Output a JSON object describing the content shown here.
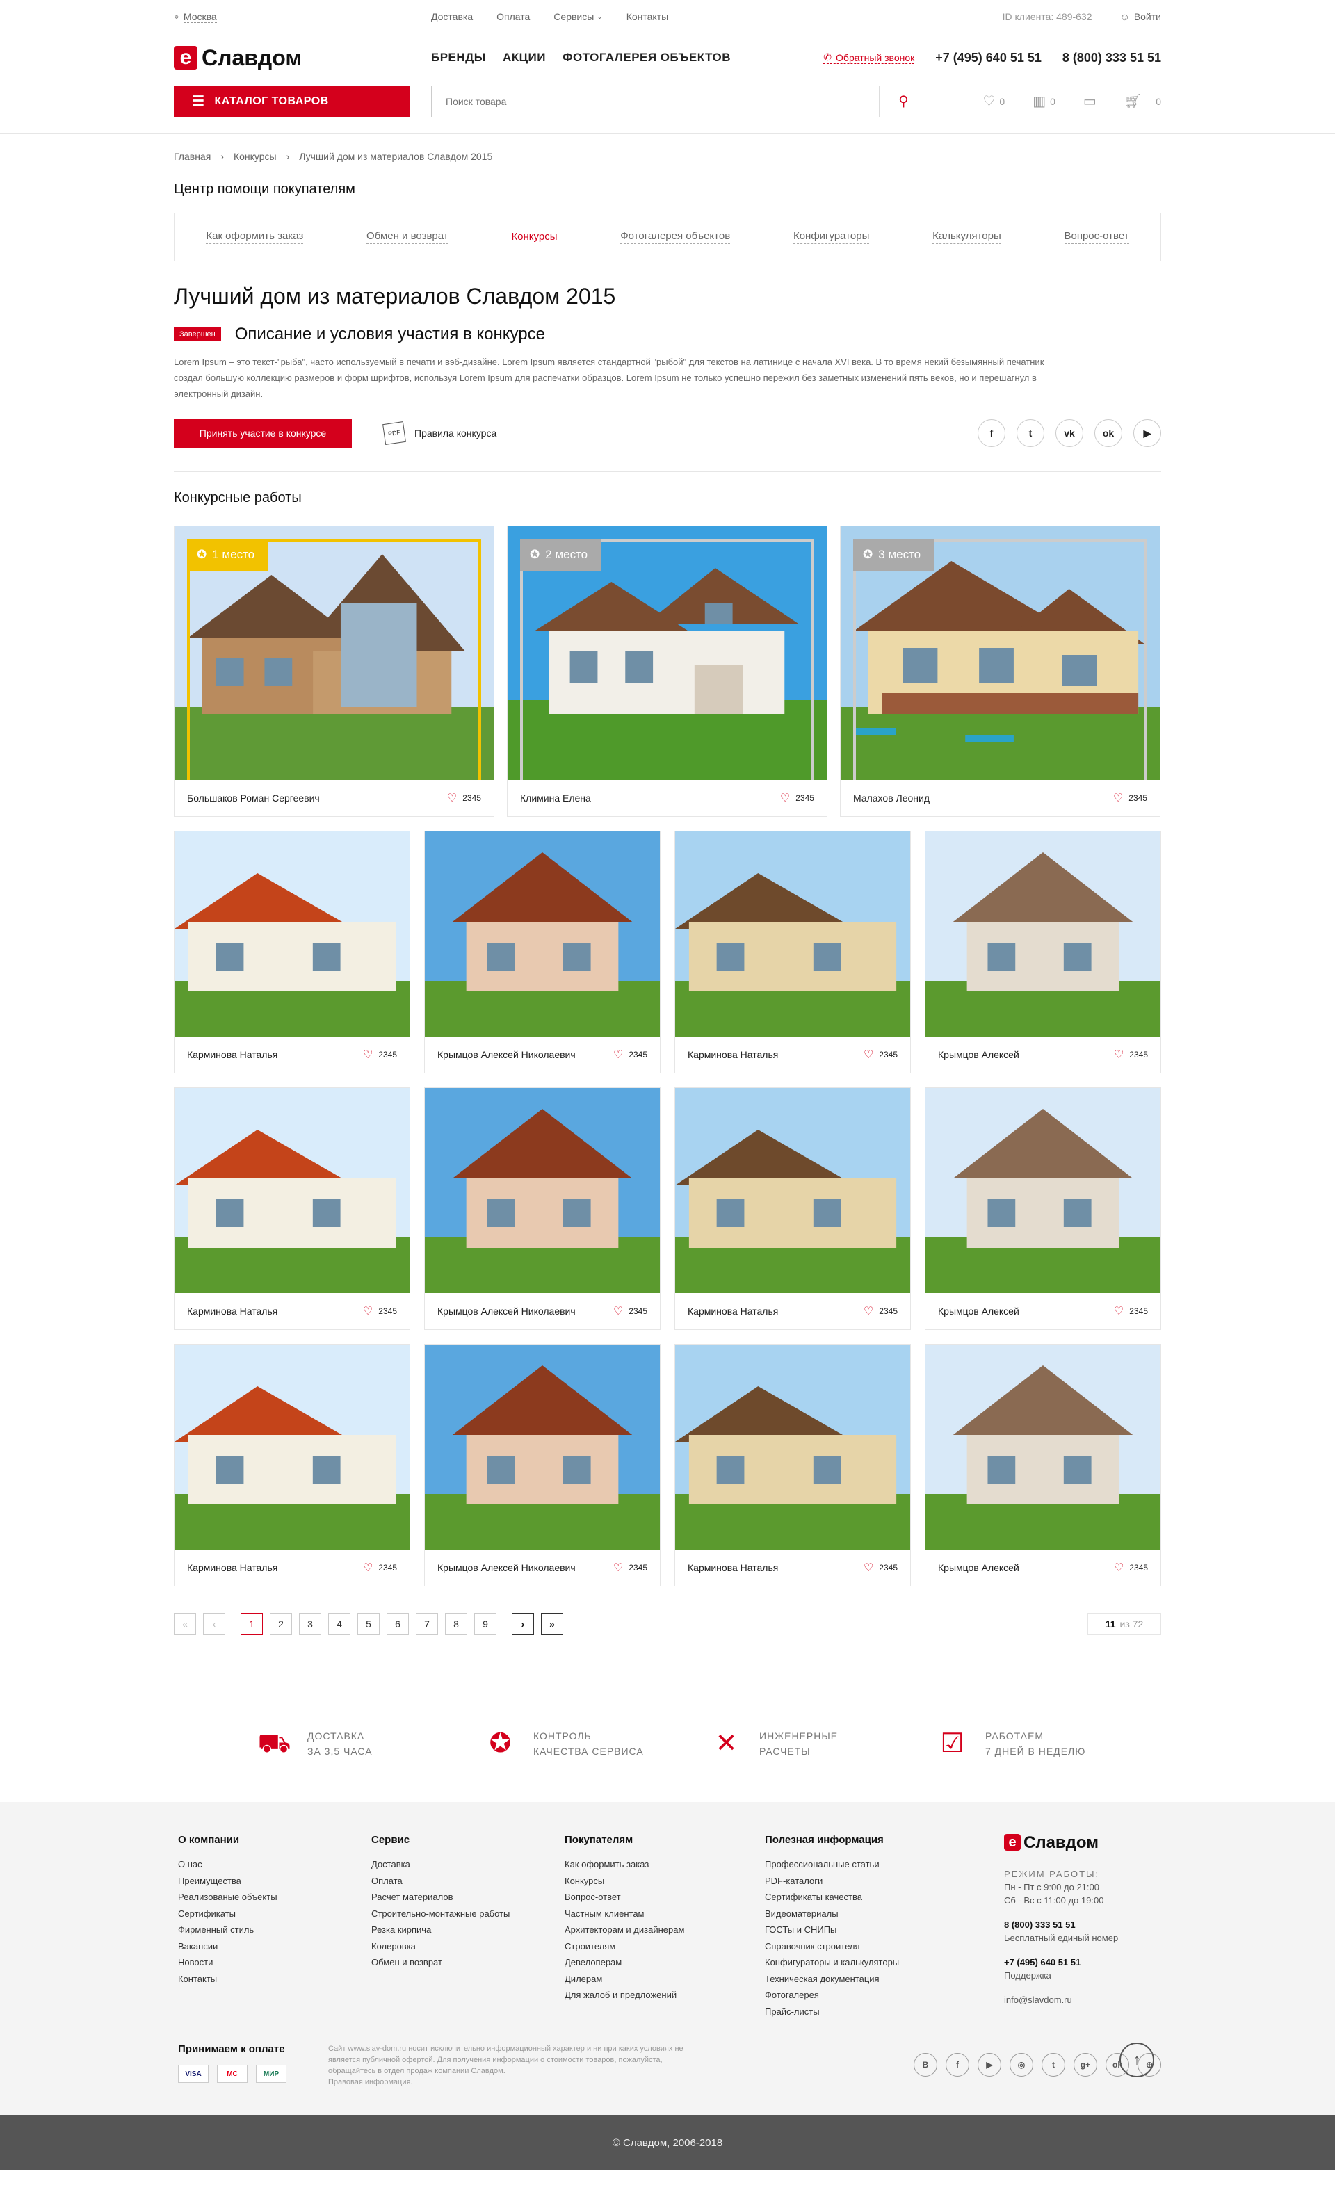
{
  "topbar": {
    "city": "Москва",
    "nav": [
      "Доставка",
      "Оплата",
      "Сервисы",
      "Контакты"
    ],
    "client_id": "ID клиента: 489-632",
    "login": "Войти"
  },
  "header": {
    "logo": "Славдом",
    "nav": [
      "БРЕНДЫ",
      "АКЦИИ",
      "ФОТОГАЛЕРЕЯ ОБЪЕКТОВ"
    ],
    "callback": "Обратный звонок",
    "phone1": "+7 (495) 640 51 51",
    "phone2": "8 (800) 333 51 51"
  },
  "search": {
    "catalog": "КАТАЛОГ ТОВАРОВ",
    "placeholder": "Поиск товара",
    "fav_count": "0",
    "compare_count": "0",
    "cart_count": "0"
  },
  "breadcrumbs": [
    "Главная",
    "Конкурсы",
    "Лучший дом из материалов Славдом 2015"
  ],
  "help": {
    "title": "Центр помощи покупателям",
    "tabs": [
      "Как оформить заказ",
      "Обмен и возврат",
      "Конкурсы",
      "Фотогалерея объектов",
      "Конфигураторы",
      "Калькуляторы",
      "Вопрос-ответ"
    ],
    "active": 2
  },
  "contest": {
    "title": "Лучший дом из материалов Славдом 2015",
    "badge": "Завершен",
    "subtitle": "Описание и условия участия в конкурсе",
    "text": "Lorem Ipsum – это текст-\"рыба\", часто используемый в печати и вэб-дизайне. Lorem Ipsum является стандартной \"рыбой\" для текстов на латинице с начала XVI века. В то время некий безымянный печатник создал большую коллекцию размеров и форм шрифтов, используя Lorem Ipsum для распечатки образцов. Lorem Ipsum не только успешно пережил без заметных изменений пять веков, но и перешагнул в электронный дизайн.",
    "join": "Принять участие в конкурсе",
    "rules": "Правила конкурса",
    "pdf": "PDF"
  },
  "socials": [
    "f",
    "t",
    "vk",
    "ok",
    "▶"
  ],
  "works": {
    "title": "Конкурсные работы",
    "top": [
      {
        "place": "1 место",
        "name": "Большаков Роман Сергеевич",
        "likes": "2345"
      },
      {
        "place": "2 место",
        "name": "Климина Елена",
        "likes": "2345"
      },
      {
        "place": "3 место",
        "name": "Малахов Леонид",
        "likes": "2345"
      }
    ],
    "rows": [
      [
        {
          "name": "Карминова Наталья",
          "likes": "2345"
        },
        {
          "name": "Крымцов Алексей Николаевич",
          "likes": "2345"
        },
        {
          "name": "Карминова Наталья",
          "likes": "2345"
        },
        {
          "name": "Крымцов Алексей",
          "likes": "2345"
        }
      ],
      [
        {
          "name": "Карминова Наталья",
          "likes": "2345"
        },
        {
          "name": "Крымцов Алексей Николаевич",
          "likes": "2345"
        },
        {
          "name": "Карминова Наталья",
          "likes": "2345"
        },
        {
          "name": "Крымцов Алексей",
          "likes": "2345"
        }
      ],
      [
        {
          "name": "Карминова Наталья",
          "likes": "2345"
        },
        {
          "name": "Крымцов Алексей Николаевич",
          "likes": "2345"
        },
        {
          "name": "Карминова Наталья",
          "likes": "2345"
        },
        {
          "name": "Крымцов Алексей",
          "likes": "2345"
        }
      ]
    ]
  },
  "pager": {
    "first": "«",
    "prev": "‹",
    "pages": [
      "1",
      "2",
      "3",
      "4",
      "5",
      "6",
      "7",
      "8",
      "9"
    ],
    "next": "›",
    "last": "»",
    "current": "11",
    "of": "из 72"
  },
  "features": [
    {
      "l1": "ДОСТАВКА",
      "l2": "ЗА 3,5 ЧАСА"
    },
    {
      "l1": "КОНТРОЛЬ",
      "l2": "КАЧЕСТВА СЕРВИСА"
    },
    {
      "l1": "ИНЖЕНЕРНЫЕ",
      "l2": "РАСЧЕТЫ"
    },
    {
      "l1": "РАБОТАЕМ",
      "l2": "7 ДНЕЙ В НЕДЕЛЮ"
    }
  ],
  "footer": {
    "cols": [
      {
        "title": "О компании",
        "items": [
          "О нас",
          "Преимущества",
          "Реализованые объекты",
          "Сертификаты",
          "Фирменный стиль",
          "Вакансии",
          "Новости",
          "Контакты"
        ]
      },
      {
        "title": "Сервис",
        "items": [
          "Доставка",
          "Оплата",
          "Расчет материалов",
          "Строительно-монтажные работы",
          "Резка кирпича",
          "Колеровка",
          "Обмен и возврат"
        ]
      },
      {
        "title": "Покупателям",
        "items": [
          "Как оформить заказ",
          "Конкурсы",
          "Вопрос-ответ",
          "Частным клиентам",
          "Архитекторам и дизайнерам",
          "Строителям",
          "Девелоперам",
          "Дилерам",
          "Для жалоб и предложений"
        ]
      },
      {
        "title": "Полезная информация",
        "items": [
          "Профессиональные статьи",
          "PDF-каталоги",
          "Сертификаты качества",
          "Видеоматериалы",
          "ГОСТы и СНИПы",
          "Справочник строителя",
          "Конфигураторы и калькуляторы",
          "Техническая документация",
          "Фотогалерея",
          "Прайс-листы"
        ]
      }
    ],
    "logo": "Славдом",
    "hours_title": "РЕЖИМ РАБОТЫ:",
    "hours1": "Пн - Пт с 9:00 до 21:00",
    "hours2": "Сб - Вс с 11:00 до 19:00",
    "phone1": "8 (800) 333 51 51",
    "phone1_note": "Бесплатный единый номер",
    "phone2": "+7 (495) 640 51 51",
    "phone2_note": "Поддержка",
    "email": "info@slavdom.ru",
    "pay_title": "Принимаем к оплате",
    "pay": [
      "VISA",
      "MC",
      "МИР"
    ],
    "legal": "Сайт www.slav-dom.ru носит исключительно информационный характер и ни при каких условиях не является публичной офертой. Для получения информации о стоимости товаров, пожалуйста, обращайтесь в отдел продаж компании Славдом.",
    "legal_link": "Правовая информация.",
    "socials": [
      "B",
      "f",
      "▶",
      "◎",
      "t",
      "g+",
      "ok",
      "⊕"
    ],
    "copyright": "© Славдом, 2006-2018"
  },
  "colors": {
    "accent": "#d4001c",
    "gold": "#f2c200"
  }
}
